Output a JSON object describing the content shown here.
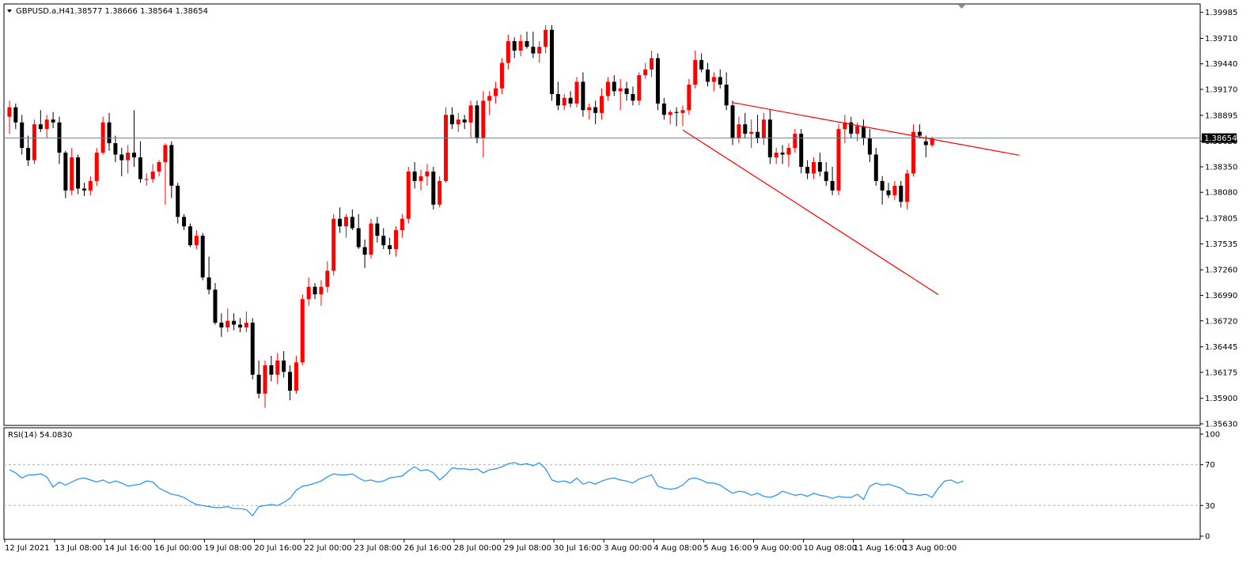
{
  "header": {
    "symbol": "GBPUSD.a,H4",
    "ohlc": "1.38577 1.38666 1.38564 1.38654",
    "current_price_label": "1.38654"
  },
  "rsi_panel": {
    "label": "RSI(14) 54.0830",
    "levels": [
      70,
      30
    ],
    "axis_ticks": [
      "100",
      "70",
      "30",
      "0"
    ]
  },
  "colors": {
    "bull": "#ff0000",
    "bear": "#000000",
    "rsi_line": "#1e90ff",
    "trendline": "#ff0000",
    "price_line": "#708090",
    "current_price_bg": "#000000"
  },
  "chart_data": [
    {
      "type": "candlestick",
      "symbol": "GBPUSD.a",
      "timeframe": "H4",
      "ylim": [
        1.3563,
        1.3999
      ],
      "y_ticks": [
        "1.39985",
        "1.39710",
        "1.39440",
        "1.39170",
        "1.38895",
        "1.38620",
        "1.38350",
        "1.38080",
        "1.37805",
        "1.37535",
        "1.37260",
        "1.36990",
        "1.36720",
        "1.36445",
        "1.36175",
        "1.35900",
        "1.35630"
      ],
      "x_ticks": [
        "12 Jul 2021",
        "13 Jul 08:00",
        "14 Jul 16:00",
        "16 Jul 00:00",
        "19 Jul 08:00",
        "20 Jul 16:00",
        "22 Jul 00:00",
        "23 Jul 08:00",
        "26 Jul 16:00",
        "28 Jul 00:00",
        "29 Jul 08:00",
        "30 Jul 16:00",
        "3 Aug 00:00",
        "4 Aug 08:00",
        "5 Aug 16:00",
        "9 Aug 00:00",
        "10 Aug 08:00",
        "11 Aug 16:00",
        "13 Aug 00:00"
      ],
      "current_price": 1.38654,
      "candles": [
        [
          1.3888,
          1.3905,
          1.387,
          1.3898
        ],
        [
          1.3898,
          1.3902,
          1.3875,
          1.3882
        ],
        [
          1.3882,
          1.389,
          1.3848,
          1.3855
        ],
        [
          1.3855,
          1.3868,
          1.3836,
          1.3842
        ],
        [
          1.3842,
          1.3885,
          1.3838,
          1.388
        ],
        [
          1.388,
          1.3895,
          1.3872,
          1.3875
        ],
        [
          1.3875,
          1.389,
          1.3865,
          1.3885
        ],
        [
          1.3885,
          1.3893,
          1.3876,
          1.3882
        ],
        [
          1.3882,
          1.3888,
          1.3838,
          1.385
        ],
        [
          1.385,
          1.3852,
          1.3802,
          1.381
        ],
        [
          1.381,
          1.3855,
          1.3805,
          1.3845
        ],
        [
          1.3845,
          1.3848,
          1.3806,
          1.3812
        ],
        [
          1.3812,
          1.3818,
          1.3804,
          1.381
        ],
        [
          1.381,
          1.3825,
          1.3805,
          1.382
        ],
        [
          1.382,
          1.3855,
          1.3815,
          1.385
        ],
        [
          1.385,
          1.3888,
          1.3848,
          1.3882
        ],
        [
          1.3882,
          1.3892,
          1.3852,
          1.386
        ],
        [
          1.386,
          1.3868,
          1.384,
          1.3848
        ],
        [
          1.3848,
          1.3855,
          1.3825,
          1.3842
        ],
        [
          1.3842,
          1.3858,
          1.3828,
          1.385
        ],
        [
          1.385,
          1.3895,
          1.3835,
          1.3845
        ],
        [
          1.3845,
          1.3862,
          1.3818,
          1.3822
        ],
        [
          1.3822,
          1.3828,
          1.3815,
          1.3822
        ],
        [
          1.3822,
          1.3838,
          1.3818,
          1.383
        ],
        [
          1.383,
          1.3842,
          1.3825,
          1.384
        ],
        [
          1.384,
          1.386,
          1.3795,
          1.3858
        ],
        [
          1.3858,
          1.3862,
          1.3802,
          1.3815
        ],
        [
          1.3815,
          1.3818,
          1.3775,
          1.3782
        ],
        [
          1.3782,
          1.3785,
          1.3768,
          1.3772
        ],
        [
          1.3772,
          1.3775,
          1.375,
          1.3752
        ],
        [
          1.3752,
          1.3768,
          1.3748,
          1.3762
        ],
        [
          1.3762,
          1.3765,
          1.3715,
          1.3718
        ],
        [
          1.3718,
          1.374,
          1.37,
          1.3705
        ],
        [
          1.3705,
          1.3712,
          1.3668,
          1.367
        ],
        [
          1.367,
          1.368,
          1.3655,
          1.3665
        ],
        [
          1.3665,
          1.3685,
          1.366,
          1.3672
        ],
        [
          1.3672,
          1.368,
          1.3662,
          1.3668
        ],
        [
          1.3668,
          1.3675,
          1.366,
          1.3665
        ],
        [
          1.3665,
          1.3682,
          1.366,
          1.367
        ],
        [
          1.367,
          1.3675,
          1.361,
          1.3615
        ],
        [
          1.3615,
          1.363,
          1.359,
          1.3595
        ],
        [
          1.3595,
          1.363,
          1.358,
          1.3625
        ],
        [
          1.3625,
          1.3635,
          1.3608,
          1.3615
        ],
        [
          1.3615,
          1.3638,
          1.3605,
          1.363
        ],
        [
          1.363,
          1.364,
          1.3612,
          1.3618
        ],
        [
          1.3618,
          1.3625,
          1.3588,
          1.3598
        ],
        [
          1.3598,
          1.3635,
          1.3595,
          1.3628
        ],
        [
          1.3628,
          1.37,
          1.3625,
          1.3695
        ],
        [
          1.3695,
          1.3718,
          1.3688,
          1.3708
        ],
        [
          1.3708,
          1.3712,
          1.3695,
          1.37
        ],
        [
          1.37,
          1.3715,
          1.3688,
          1.3708
        ],
        [
          1.3708,
          1.3735,
          1.3702,
          1.3725
        ],
        [
          1.3725,
          1.3785,
          1.372,
          1.378
        ],
        [
          1.378,
          1.3792,
          1.3765,
          1.3772
        ],
        [
          1.3772,
          1.3785,
          1.376,
          1.3782
        ],
        [
          1.3782,
          1.379,
          1.3768,
          1.377
        ],
        [
          1.377,
          1.3785,
          1.3748,
          1.375
        ],
        [
          1.375,
          1.3758,
          1.3728,
          1.3742
        ],
        [
          1.3742,
          1.378,
          1.3738,
          1.3775
        ],
        [
          1.3775,
          1.3782,
          1.3755,
          1.3762
        ],
        [
          1.3762,
          1.377,
          1.3748,
          1.3752
        ],
        [
          1.3752,
          1.376,
          1.3742,
          1.3748
        ],
        [
          1.3748,
          1.3772,
          1.374,
          1.3768
        ],
        [
          1.3768,
          1.3785,
          1.376,
          1.378
        ],
        [
          1.378,
          1.3835,
          1.3775,
          1.383
        ],
        [
          1.383,
          1.384,
          1.3812,
          1.382
        ],
        [
          1.382,
          1.3832,
          1.381,
          1.3825
        ],
        [
          1.3825,
          1.3838,
          1.3815,
          1.383
        ],
        [
          1.383,
          1.3835,
          1.379,
          1.3795
        ],
        [
          1.3795,
          1.3825,
          1.3792,
          1.382
        ],
        [
          1.382,
          1.3898,
          1.3818,
          1.389
        ],
        [
          1.389,
          1.3898,
          1.3875,
          1.388
        ],
        [
          1.388,
          1.3892,
          1.3872,
          1.3885
        ],
        [
          1.3885,
          1.389,
          1.3875,
          1.3882
        ],
        [
          1.3882,
          1.3905,
          1.3865,
          1.39
        ],
        [
          1.39,
          1.3905,
          1.386,
          1.3865
        ],
        [
          1.3865,
          1.3915,
          1.3845,
          1.3905
        ],
        [
          1.3905,
          1.3915,
          1.389,
          1.391
        ],
        [
          1.391,
          1.3925,
          1.3902,
          1.3918
        ],
        [
          1.3918,
          1.395,
          1.3912,
          1.3945
        ],
        [
          1.3945,
          1.3975,
          1.3938,
          1.3968
        ],
        [
          1.3968,
          1.3972,
          1.395,
          1.3958
        ],
        [
          1.3958,
          1.3975,
          1.3952,
          1.3968
        ],
        [
          1.3968,
          1.3978,
          1.396,
          1.3962
        ],
        [
          1.3962,
          1.3978,
          1.395,
          1.3955
        ],
        [
          1.3955,
          1.3968,
          1.3945,
          1.3962
        ],
        [
          1.3962,
          1.3985,
          1.3955,
          1.398
        ],
        [
          1.398,
          1.3985,
          1.3905,
          1.3912
        ],
        [
          1.3912,
          1.3925,
          1.3895,
          1.39
        ],
        [
          1.39,
          1.3912,
          1.3895,
          1.3908
        ],
        [
          1.3908,
          1.3915,
          1.3898,
          1.3902
        ],
        [
          1.3902,
          1.393,
          1.3898,
          1.3925
        ],
        [
          1.3925,
          1.3935,
          1.3888,
          1.3895
        ],
        [
          1.3895,
          1.3902,
          1.3885,
          1.3898
        ],
        [
          1.3898,
          1.3905,
          1.388,
          1.3892
        ],
        [
          1.3892,
          1.3918,
          1.3885,
          1.391
        ],
        [
          1.391,
          1.393,
          1.3905,
          1.3925
        ],
        [
          1.3925,
          1.3932,
          1.391,
          1.3915
        ],
        [
          1.3915,
          1.3928,
          1.3895,
          1.3918
        ],
        [
          1.3918,
          1.3925,
          1.3905,
          1.3912
        ],
        [
          1.3912,
          1.392,
          1.39,
          1.3905
        ],
        [
          1.3905,
          1.3935,
          1.39,
          1.3932
        ],
        [
          1.3932,
          1.3945,
          1.3928,
          1.3938
        ],
        [
          1.3938,
          1.3958,
          1.393,
          1.395
        ],
        [
          1.395,
          1.3955,
          1.3895,
          1.3902
        ],
        [
          1.3902,
          1.3908,
          1.3885,
          1.389
        ],
        [
          1.389,
          1.3895,
          1.388,
          1.3893
        ],
        [
          1.3893,
          1.3898,
          1.3878,
          1.3892
        ],
        [
          1.3892,
          1.39,
          1.3878,
          1.3895
        ],
        [
          1.3895,
          1.3928,
          1.389,
          1.3922
        ],
        [
          1.3922,
          1.3958,
          1.3918,
          1.3948
        ],
        [
          1.3948,
          1.3955,
          1.3935,
          1.3938
        ],
        [
          1.3938,
          1.3945,
          1.392,
          1.3925
        ],
        [
          1.3925,
          1.3935,
          1.3915,
          1.393
        ],
        [
          1.393,
          1.3938,
          1.3918,
          1.3922
        ],
        [
          1.3922,
          1.3935,
          1.3895,
          1.39
        ],
        [
          1.39,
          1.3905,
          1.3858,
          1.3865
        ],
        [
          1.3865,
          1.3888,
          1.386,
          1.388
        ],
        [
          1.388,
          1.3892,
          1.3865,
          1.387
        ],
        [
          1.387,
          1.3885,
          1.3855,
          1.3872
        ],
        [
          1.3872,
          1.389,
          1.386,
          1.3865
        ],
        [
          1.3865,
          1.3892,
          1.3858,
          1.3885
        ],
        [
          1.3885,
          1.3895,
          1.3838,
          1.3845
        ],
        [
          1.3845,
          1.3855,
          1.3838,
          1.385
        ],
        [
          1.385,
          1.3858,
          1.3838,
          1.3848
        ],
        [
          1.3848,
          1.386,
          1.3835,
          1.3855
        ],
        [
          1.3855,
          1.3875,
          1.385,
          1.387
        ],
        [
          1.387,
          1.3875,
          1.3828,
          1.3835
        ],
        [
          1.3835,
          1.3842,
          1.3822,
          1.3828
        ],
        [
          1.3828,
          1.3845,
          1.3822,
          1.384
        ],
        [
          1.384,
          1.385,
          1.3825,
          1.383
        ],
        [
          1.383,
          1.384,
          1.3815,
          1.382
        ],
        [
          1.382,
          1.3835,
          1.3805,
          1.381
        ],
        [
          1.381,
          1.388,
          1.3805,
          1.3875
        ],
        [
          1.3875,
          1.389,
          1.386,
          1.3882
        ],
        [
          1.3882,
          1.3888,
          1.3865,
          1.387
        ],
        [
          1.387,
          1.3882,
          1.3862,
          1.3878
        ],
        [
          1.3878,
          1.3885,
          1.3858,
          1.3865
        ],
        [
          1.3865,
          1.3875,
          1.384,
          1.3848
        ],
        [
          1.3848,
          1.3855,
          1.3815,
          1.382
        ],
        [
          1.382,
          1.3825,
          1.3795,
          1.381
        ],
        [
          1.381,
          1.3818,
          1.3802,
          1.3805
        ],
        [
          1.3805,
          1.382,
          1.38,
          1.3815
        ],
        [
          1.3815,
          1.382,
          1.3792,
          1.3798
        ],
        [
          1.3798,
          1.3832,
          1.379,
          1.3828
        ],
        [
          1.3828,
          1.388,
          1.3825,
          1.3872
        ],
        [
          1.3872,
          1.388,
          1.3865,
          1.3868
        ],
        [
          1.3862,
          1.3868,
          1.3845,
          1.3858
        ],
        [
          1.3858,
          1.3867,
          1.3856,
          1.3865
        ]
      ],
      "trendlines": [
        {
          "from_candle": 116,
          "from_price": 1.3903,
          "to_candle": 149,
          "to_price": 1.3863,
          "extends_past_last_bar": true
        },
        {
          "from_candle": 108,
          "from_price": 1.3874,
          "to_candle": 136,
          "to_price": 1.3755,
          "extends_past_last_bar": true
        }
      ]
    },
    {
      "type": "line",
      "name": "RSI(14)",
      "ylim": [
        0,
        100
      ],
      "levels": [
        70,
        30
      ],
      "values": [
        65,
        62,
        57,
        60,
        60,
        61,
        58,
        48,
        53,
        50,
        53,
        56,
        57,
        55,
        53,
        55,
        52,
        54,
        52,
        49,
        50,
        51,
        54,
        53,
        47,
        44,
        41,
        40,
        38,
        34,
        31,
        30,
        29,
        28,
        28,
        29,
        27,
        27,
        26,
        20,
        29,
        30,
        31,
        30,
        33,
        37,
        45,
        49,
        50,
        52,
        54,
        58,
        61,
        60,
        60,
        61,
        57,
        54,
        55,
        53,
        54,
        57,
        58,
        59,
        64,
        68,
        64,
        65,
        62,
        55,
        60,
        67,
        66,
        66,
        65,
        66,
        62,
        65,
        66,
        68,
        71,
        72,
        70,
        71,
        69,
        72,
        66,
        55,
        53,
        54,
        52,
        57,
        51,
        53,
        51,
        54,
        56,
        57,
        55,
        54,
        52,
        56,
        58,
        60,
        49,
        47,
        46,
        47,
        50,
        56,
        57,
        55,
        52,
        52,
        50,
        46,
        42,
        44,
        43,
        40,
        42,
        39,
        38,
        40,
        44,
        42,
        40,
        41,
        39,
        42,
        40,
        39,
        37,
        39,
        38,
        38,
        41,
        36,
        49,
        52,
        50,
        51,
        49,
        47,
        42,
        41,
        40,
        41,
        38,
        47,
        54,
        55,
        52,
        54
      ]
    }
  ]
}
